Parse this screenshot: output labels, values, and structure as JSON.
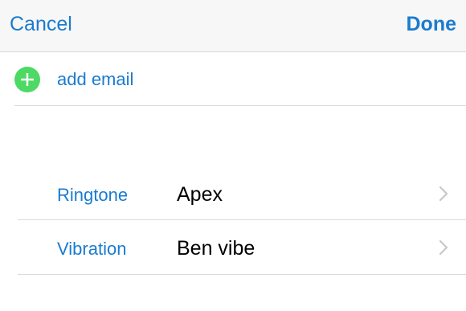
{
  "navbar": {
    "cancel_label": "Cancel",
    "done_label": "Done"
  },
  "email": {
    "add_label": "add email",
    "icon": "plus-circle-icon"
  },
  "settings": [
    {
      "label": "Ringtone",
      "value": "Apex",
      "icon": "chevron-right-icon"
    },
    {
      "label": "Vibration",
      "value": "Ben vibe",
      "icon": "chevron-right-icon"
    }
  ],
  "colors": {
    "accent": "#1a7bd0",
    "add_green": "#4cd964",
    "navbar_bg": "#f7f7f7",
    "separator": "#dadadd",
    "chevron": "#c7c7cc"
  }
}
